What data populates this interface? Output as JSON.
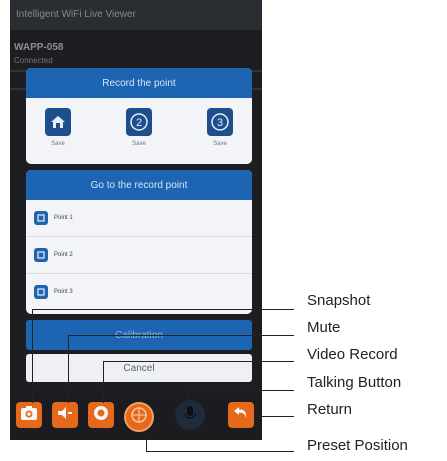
{
  "screen": {
    "app_title": "Intelligent WiFi Live Viewer",
    "device_name": "WAPP-058",
    "device_status": "Connected"
  },
  "dialog": {
    "record_title": "Record the point",
    "save_buttons": [
      {
        "label": "Save",
        "icon": "home-icon"
      },
      {
        "label": "Save",
        "icon": "number-2-icon"
      },
      {
        "label": "Save",
        "icon": "number-3-icon"
      }
    ],
    "goto_title": "Go to the record point",
    "points": [
      {
        "label": "Point 1",
        "icon": "point-icon"
      },
      {
        "label": "Point 2",
        "icon": "point-icon"
      },
      {
        "label": "Point 3",
        "icon": "point-icon"
      }
    ],
    "calibration_label": "Calibration",
    "cancel_label": "Cancel"
  },
  "toolbar": {
    "buttons": [
      {
        "name": "snapshot-button",
        "icon": "camera-icon"
      },
      {
        "name": "mute-button",
        "icon": "speaker-icon"
      },
      {
        "name": "video-record-button",
        "icon": "record-icon"
      },
      {
        "name": "preset-position-button",
        "icon": "crosshair-icon"
      },
      {
        "name": "talking-button",
        "icon": "microphone-icon"
      },
      {
        "name": "return-button",
        "icon": "return-arrow-icon"
      }
    ]
  },
  "callouts": {
    "snapshot": "Snapshot",
    "mute": "Mute",
    "video_record": "Video Record",
    "talking_button": "Talking Button",
    "return": "Return",
    "preset_position": "Preset Position"
  },
  "colors": {
    "accent_blue": "#1d64b2",
    "toolbar_orange": "#e5681b",
    "screen_background": "#1c1e21"
  }
}
